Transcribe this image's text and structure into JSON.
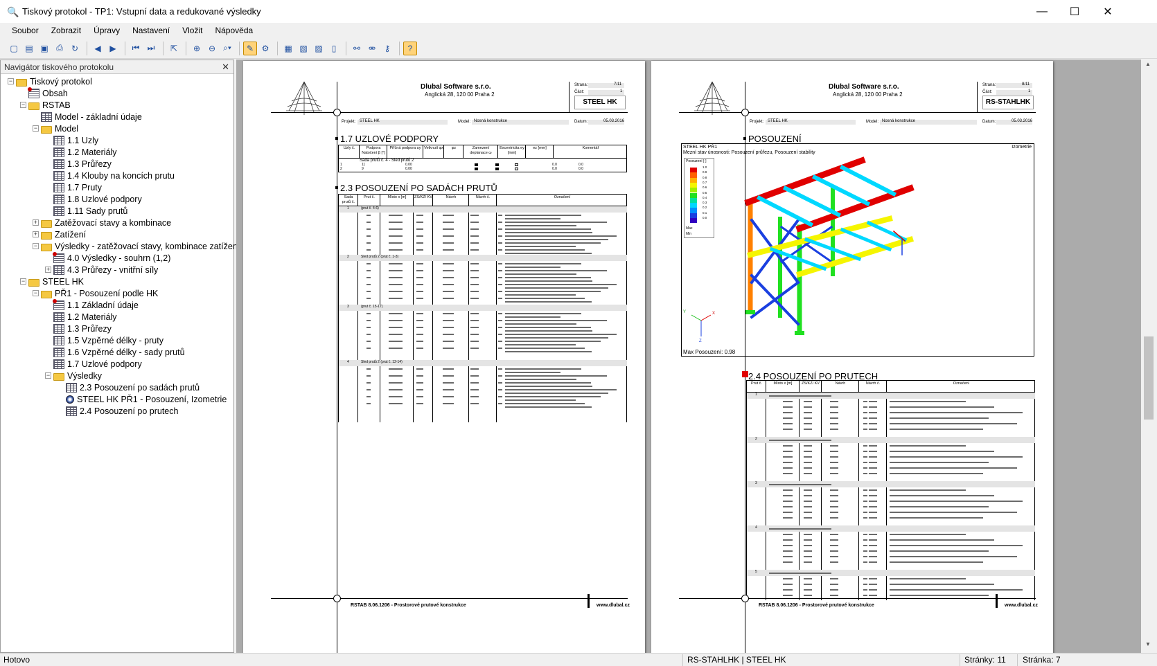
{
  "window": {
    "title": "Tiskový protokol - TP1: Vstupní data a redukované výsledky",
    "minimize": "—",
    "maximize": "☐",
    "close": "✕"
  },
  "menu": [
    "Soubor",
    "Zobrazit",
    "Úpravy",
    "Nastavení",
    "Vložit",
    "Nápověda"
  ],
  "navigator": {
    "title": "Navigátor tiskového protokolu",
    "items": [
      {
        "label": "Tiskový protokol",
        "level": 0,
        "icon": "folder",
        "exp": "−"
      },
      {
        "label": "Obsah",
        "level": 1,
        "icon": "tred",
        "exp": ""
      },
      {
        "label": "RSTAB",
        "level": 1,
        "icon": "folder",
        "exp": "−"
      },
      {
        "label": "Model - základní údaje",
        "level": 2,
        "icon": "table",
        "exp": ""
      },
      {
        "label": "Model",
        "level": 2,
        "icon": "folder",
        "exp": "−"
      },
      {
        "label": "1.1 Uzly",
        "level": 3,
        "icon": "table",
        "exp": ""
      },
      {
        "label": "1.2 Materiály",
        "level": 3,
        "icon": "table",
        "exp": ""
      },
      {
        "label": "1.3 Průřezy",
        "level": 3,
        "icon": "table",
        "exp": ""
      },
      {
        "label": "1.4 Klouby na koncích prutu",
        "level": 3,
        "icon": "table",
        "exp": ""
      },
      {
        "label": "1.7 Pruty",
        "level": 3,
        "icon": "table",
        "exp": ""
      },
      {
        "label": "1.8 Uzlové podpory",
        "level": 3,
        "icon": "table",
        "exp": ""
      },
      {
        "label": "1.11 Sady prutů",
        "level": 3,
        "icon": "table",
        "exp": ""
      },
      {
        "label": "Zatěžovací stavy a kombinace",
        "level": 2,
        "icon": "folder",
        "exp": "+"
      },
      {
        "label": "Zatížení",
        "level": 2,
        "icon": "folder",
        "exp": "+"
      },
      {
        "label": "Výsledky - zatěžovací stavy, kombinace zatížení",
        "level": 2,
        "icon": "folder",
        "exp": "−"
      },
      {
        "label": "4.0 Výsledky - souhrn (1,2)",
        "level": 3,
        "icon": "tred",
        "exp": ""
      },
      {
        "label": "4.3 Průřezy - vnitřní síly",
        "level": 3,
        "icon": "table",
        "exp": "+"
      },
      {
        "label": "STEEL HK",
        "level": 1,
        "icon": "folder",
        "exp": "−"
      },
      {
        "label": "PŘ1 - Posouzení podle HK",
        "level": 2,
        "icon": "folder",
        "exp": "−"
      },
      {
        "label": "1.1 Základní údaje",
        "level": 3,
        "icon": "tred",
        "exp": ""
      },
      {
        "label": "1.2 Materiály",
        "level": 3,
        "icon": "table",
        "exp": ""
      },
      {
        "label": "1.3 Průřezy",
        "level": 3,
        "icon": "table",
        "exp": ""
      },
      {
        "label": "1.5 Vzpěrné délky - pruty",
        "level": 3,
        "icon": "table",
        "exp": ""
      },
      {
        "label": "1.6 Vzpěrné délky - sady prutů",
        "level": 3,
        "icon": "table",
        "exp": ""
      },
      {
        "label": "1.7 Uzlové podpory",
        "level": 3,
        "icon": "table",
        "exp": ""
      },
      {
        "label": "Výsledky",
        "level": 3,
        "icon": "folder",
        "exp": "−"
      },
      {
        "label": "2.3 Posouzení po sadách prutů",
        "level": 4,
        "icon": "table",
        "exp": ""
      },
      {
        "label": "STEEL HK PŘ1 - Posouzení, Izometrie",
        "level": 4,
        "icon": "round",
        "exp": ""
      },
      {
        "label": "2.4 Posouzení po prutech",
        "level": 4,
        "icon": "table",
        "exp": ""
      }
    ]
  },
  "page_left": {
    "company": "Dlubal Software s.r.o.",
    "address": "Anglická 28, 120 00 Praha 2",
    "strana_label": "Strana:",
    "strana": "7/11",
    "cast_label": "Část:",
    "cast": "1",
    "module": "STEEL HK",
    "projekt_label": "Projekt:",
    "projekt": "STEEL HK",
    "model_label": "Model:",
    "model": "Nosná konstrukce",
    "datum_label": "Datum:",
    "datum": "05.03.2016",
    "section1": "1.7 UZLOVÉ PODPORY",
    "t1_headers": [
      "Uzly č.",
      "Podpora Natočení β [°]",
      "Příčná podpora uy",
      "Vetknutí φx",
      "φz",
      "Zamezení deplanace ω",
      "Excentricita ey [mm]",
      "ez [mm]",
      "Komentář"
    ],
    "t1_sub": "Sada prutů č. 4 - Sled prutů 2",
    "t1_rows": [
      [
        "1",
        "11",
        "0.00",
        "0.0",
        "0.0"
      ],
      [
        "2",
        "9",
        "0.00",
        "0.0",
        "0.0"
      ]
    ],
    "section2": "2.3 POSOUZENÍ PO SADÁCH PRUTŮ",
    "t2_headers": [
      "Sada prutů č.",
      "Prut č.",
      "Místo x [m]",
      "ZS/KZ/ KV",
      "Návrh",
      "Návrh č.",
      "Označení"
    ],
    "t2_groups": [
      {
        "set": "1",
        "title": "(prut č. 4-6)"
      },
      {
        "set": "2",
        "title": "Sled prutů 2 (prut č. 1-3)"
      },
      {
        "set": "3",
        "title": "(prut č. 15-17)"
      },
      {
        "set": "4",
        "title": "Sled prutů 2 (prut č. 12-14)"
      }
    ],
    "footer_left": "RSTAB 8.06.1206 - Prostorové prutové konstrukce",
    "footer_right": "www.dlubal.cz"
  },
  "page_right": {
    "company": "Dlubal Software s.r.o.",
    "address": "Anglická 28, 120 00 Praha 2",
    "strana_label": "Strana:",
    "strana": "8/11",
    "cast_label": "Část:",
    "cast": "1",
    "module": "RS-STAHLHK",
    "projekt_label": "Projekt:",
    "projekt": "STEEL HK",
    "model_label": "Model:",
    "model": "Nosná konstrukce",
    "datum_label": "Datum:",
    "datum": "05.03.2016",
    "section1": "POSOUZENÍ",
    "fig_title": "STEEL HK PŘ1",
    "fig_subtitle": "Mezní stav únosnosti: Posouzení průřezu, Posouzení stability",
    "fig_view": "Izometrie",
    "fig_legend_title": "Posouzení [-]",
    "fig_legend_values": [
      "1.0",
      "0.9",
      "0.8",
      "0.7",
      "0.6",
      "0.5",
      "0.4",
      "0.3",
      "0.2",
      "0.1",
      "0.0"
    ],
    "fig_legend_max": "Max",
    "fig_legend_min": "Min",
    "fig_axis_x": "X",
    "fig_axis_y": "Y",
    "fig_axis_z": "Z",
    "fig_max": "Max Posouzení: 0.98",
    "section2": "2.4 POSOUZENÍ PO PRUTECH",
    "t3_headers": [
      "Prut č.",
      "Místo x [m]",
      "ZS/KZ/ KV",
      "Návrh",
      "Návrh č.",
      "Označení"
    ],
    "t3_groups": [
      "1",
      "2",
      "3",
      "4",
      "5"
    ],
    "footer_left": "RSTAB 8.06.1206 - Prostorové prutové konstrukce",
    "footer_right": "www.dlubal.cz"
  },
  "status": {
    "left": "Hotovo",
    "module": "RS-STAHLHK | STEEL HK",
    "pages": "Stránky: 11",
    "page": "Stránka: 7"
  },
  "colors": {
    "red": "#e00000",
    "yellow": "#f5f500",
    "cyan": "#00d8ff",
    "blue": "#1a3fe0",
    "green": "#20e020",
    "orange": "#ff8000"
  }
}
